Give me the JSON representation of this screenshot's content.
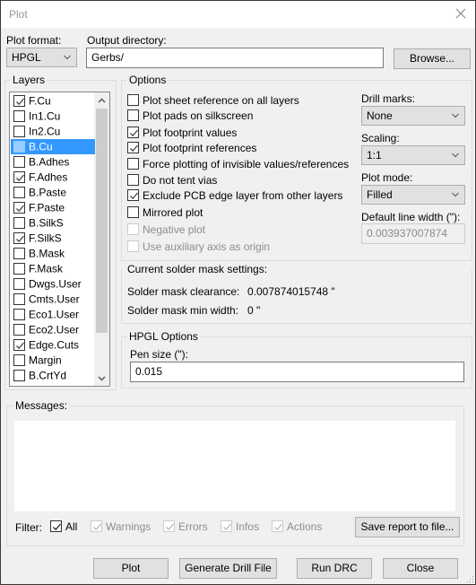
{
  "window": {
    "title": "Plot"
  },
  "plot_format": {
    "label": "Plot format:",
    "value": "HPGL"
  },
  "output_directory": {
    "label": "Output directory:",
    "value": "Gerbs/",
    "browse_label": "Browse..."
  },
  "layers": {
    "title": "Layers",
    "items": [
      {
        "name": "F.Cu",
        "checked": true,
        "selected": false
      },
      {
        "name": "In1.Cu",
        "checked": false,
        "selected": false
      },
      {
        "name": "In2.Cu",
        "checked": false,
        "selected": false
      },
      {
        "name": "B.Cu",
        "checked": false,
        "selected": true
      },
      {
        "name": "B.Adhes",
        "checked": false,
        "selected": false
      },
      {
        "name": "F.Adhes",
        "checked": true,
        "selected": false
      },
      {
        "name": "B.Paste",
        "checked": false,
        "selected": false
      },
      {
        "name": "F.Paste",
        "checked": true,
        "selected": false
      },
      {
        "name": "B.SilkS",
        "checked": false,
        "selected": false
      },
      {
        "name": "F.SilkS",
        "checked": true,
        "selected": false
      },
      {
        "name": "B.Mask",
        "checked": false,
        "selected": false
      },
      {
        "name": "F.Mask",
        "checked": false,
        "selected": false
      },
      {
        "name": "Dwgs.User",
        "checked": false,
        "selected": false
      },
      {
        "name": "Cmts.User",
        "checked": false,
        "selected": false
      },
      {
        "name": "Eco1.User",
        "checked": false,
        "selected": false
      },
      {
        "name": "Eco2.User",
        "checked": false,
        "selected": false
      },
      {
        "name": "Edge.Cuts",
        "checked": true,
        "selected": false
      },
      {
        "name": "Margin",
        "checked": false,
        "selected": false
      },
      {
        "name": "B.CrtYd",
        "checked": false,
        "selected": false
      }
    ]
  },
  "options": {
    "title": "Options",
    "checkboxes": [
      {
        "label": "Plot sheet reference on all layers",
        "checked": false,
        "disabled": false
      },
      {
        "label": "Plot pads on silkscreen",
        "checked": false,
        "disabled": false
      },
      {
        "label": "Plot footprint values",
        "checked": true,
        "disabled": false
      },
      {
        "label": "Plot footprint references",
        "checked": true,
        "disabled": false
      },
      {
        "label": "Force plotting of invisible values/references",
        "checked": false,
        "disabled": false
      },
      {
        "label": "Do not tent vias",
        "checked": false,
        "disabled": false
      },
      {
        "label": "Exclude PCB edge layer from other layers",
        "checked": true,
        "disabled": false
      },
      {
        "label": "Mirrored plot",
        "checked": false,
        "disabled": false
      },
      {
        "label": "Negative plot",
        "checked": false,
        "disabled": true
      },
      {
        "label": "Use auxiliary axis as origin",
        "checked": false,
        "disabled": true
      }
    ],
    "drill_marks": {
      "label": "Drill marks:",
      "value": "None"
    },
    "scaling": {
      "label": "Scaling:",
      "value": "1:1"
    },
    "plot_mode": {
      "label": "Plot mode:",
      "value": "Filled"
    },
    "default_line_width": {
      "label": "Default line width (\"):",
      "value": "0.003937007874"
    }
  },
  "solder_mask": {
    "title": "Current solder mask settings:",
    "clearance_label": "Solder mask clearance:",
    "clearance_value": "0.007874015748 \"",
    "min_width_label": "Solder mask min width:",
    "min_width_value": "0 \""
  },
  "hpgl": {
    "title": "HPGL Options",
    "pen_size_label": "Pen size (\"):",
    "pen_size_value": "0.015"
  },
  "messages": {
    "title": "Messages:",
    "content": "",
    "filter_label": "Filter:",
    "filters": [
      {
        "label": "All",
        "checked": true,
        "disabled": false
      },
      {
        "label": "Warnings",
        "checked": true,
        "disabled": true
      },
      {
        "label": "Errors",
        "checked": true,
        "disabled": true
      },
      {
        "label": "Infos",
        "checked": true,
        "disabled": true
      },
      {
        "label": "Actions",
        "checked": true,
        "disabled": true
      }
    ],
    "save_report_label": "Save report to file..."
  },
  "buttons": {
    "plot": "Plot",
    "generate_drill": "Generate Drill File",
    "run_drc": "Run DRC",
    "close": "Close"
  },
  "colors": {
    "selection": "#3399ff",
    "background": "#f0f0f0"
  }
}
